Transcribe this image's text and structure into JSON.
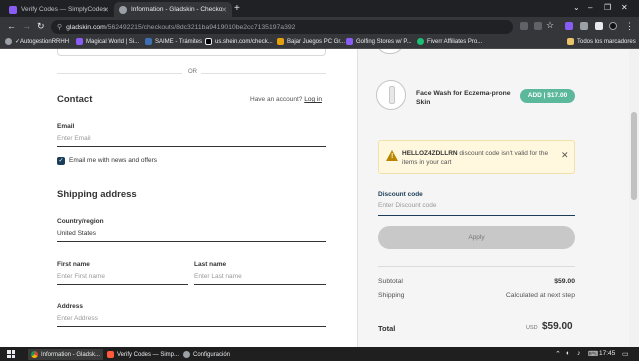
{
  "browser": {
    "tabs": [
      {
        "title": "Verify Codes — SimplyCodes",
        "active": false
      },
      {
        "title": "Information - Gladskin - Checko",
        "active": true
      }
    ],
    "url_host": "gladskin.com",
    "url_path": "/56249221​5/checkouts/8dc3211ba941​9010be2cc7135197a392",
    "bookmarks": [
      "✓AutogestionRRHH",
      "Magical World | Si...",
      "SAIME - Trámites",
      "us.shein.com/check...",
      "Bajar Juegos PC Gr...",
      "Golfing Stores w/ P...",
      "Fiverr Affiliates Pro...",
      "Todos los marcadores"
    ]
  },
  "checkout": {
    "or_text": "OR",
    "contact_heading": "Contact",
    "have_account": "Have an account?",
    "login_link": "Log in",
    "email_label": "Email",
    "email_placeholder": "Enter Email",
    "newsletter_label": "Email me with news and offers",
    "newsletter_checked": true,
    "shipping_heading": "Shipping address",
    "country_label": "Country/region",
    "country_value": "United States",
    "first_name_label": "First name",
    "first_name_placeholder": "Enter First name",
    "last_name_label": "Last name",
    "last_name_placeholder": "Enter Last name",
    "address_label": "Address",
    "address_placeholder": "Enter Address"
  },
  "summary": {
    "upsell_product": "Face Wash for Eczema-prone Skin",
    "upsell_button": "ADD | $17.00",
    "alert_code": "HELLOZ4ZDLLRN",
    "alert_text": " discount code isn't valid for the items in your cart",
    "discount_label": "Discount code",
    "discount_placeholder": "Enter Discount code",
    "apply_label": "Apply",
    "subtotal_label": "Subtotal",
    "subtotal_value": "$59.00",
    "shipping_label": "Shipping",
    "shipping_value": "Calculated at next step",
    "total_label": "Total",
    "total_currency": "USD",
    "total_value": "$59.00"
  },
  "taskbar": {
    "items": [
      "Information - Gladsk...",
      "Verify Codes — Simp...",
      "Configuración"
    ],
    "clock": "17:45"
  },
  "colors": {
    "accent": "#1c3d5a",
    "add_button": "#5bb89a",
    "alert_bg": "#fff8de",
    "warning": "#b88600"
  }
}
